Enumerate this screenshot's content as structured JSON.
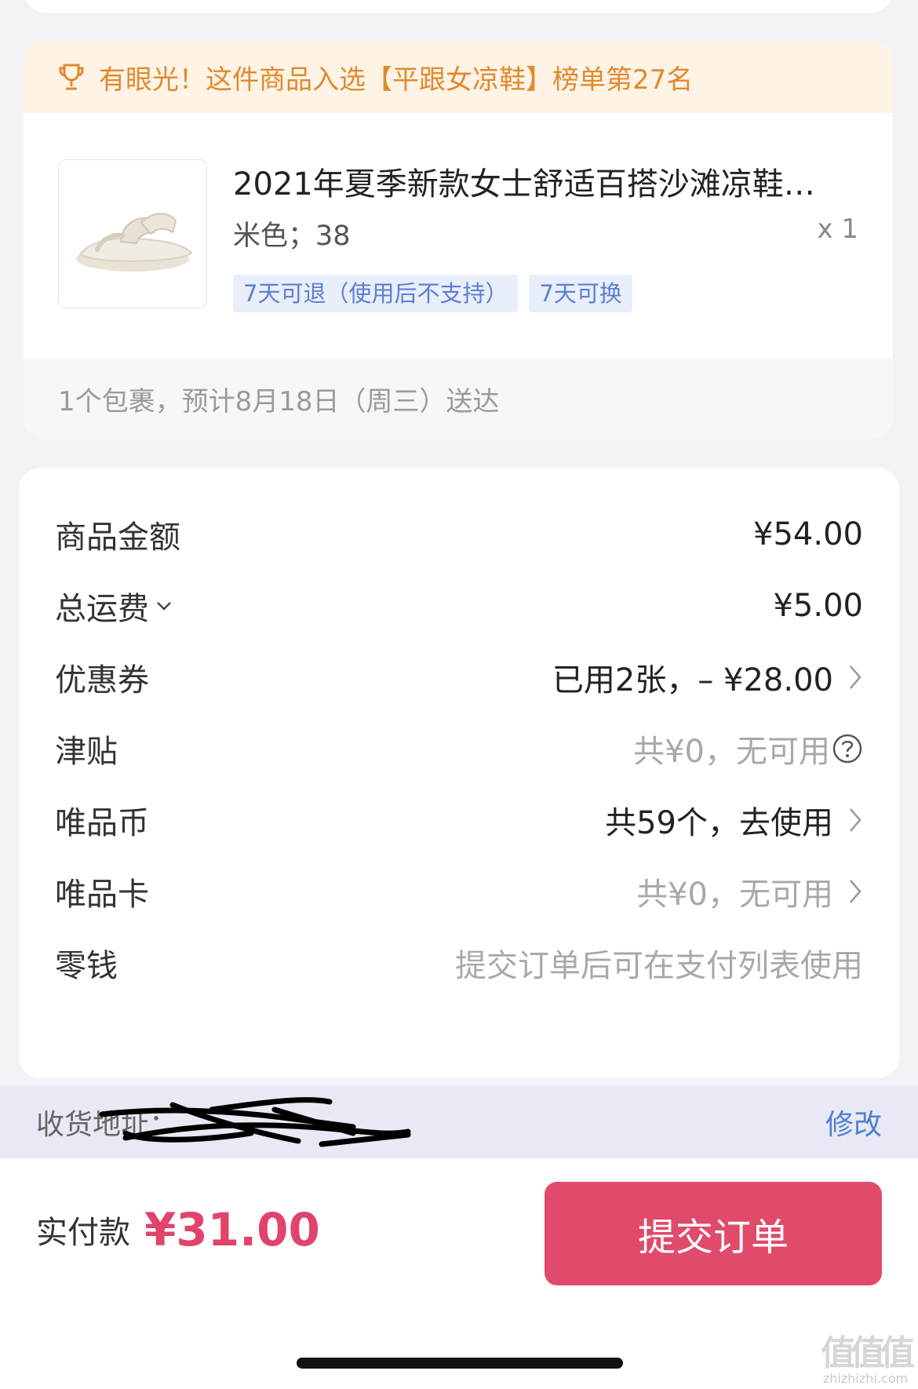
{
  "rank_banner": {
    "text": "有眼光！这件商品入选【平跟女凉鞋】榜单第27名"
  },
  "product": {
    "name": "2021年夏季新款女士舒适百搭沙滩凉鞋…",
    "sku": "米色；38",
    "qty": "x 1",
    "tags": [
      "7天可退（使用后不支持）",
      "7天可换"
    ]
  },
  "delivery": {
    "text": "1个包裹，预计8月18日（周三）送达"
  },
  "summary": {
    "rows": [
      {
        "label": "商品金额",
        "value": "¥54.00"
      },
      {
        "label": "总运费",
        "value": "¥5.00"
      },
      {
        "label": "优惠券",
        "value": "已用2张，– ¥28.00"
      },
      {
        "label": "津贴",
        "value": "共¥0，无可用"
      },
      {
        "label": "唯品币",
        "value": "共59个，去使用"
      },
      {
        "label": "唯品卡",
        "value": "共¥0，无可用"
      },
      {
        "label": "零钱",
        "value": "提交订单后可在支付列表使用"
      }
    ]
  },
  "address": {
    "label": "收货地址：",
    "edit_label": "修改"
  },
  "footer": {
    "total_label": "实付款",
    "total_amount": "¥31.00",
    "submit_label": "提交订单"
  },
  "watermark": {
    "glyphs": "值值值",
    "site": "zhizhizhi.com"
  },
  "colors": {
    "accent": "#e04a6b",
    "banner_text": "#e08a2c",
    "banner_bg": "#fff3e6",
    "tag_text": "#5b7fd1",
    "link": "#4f7fd1"
  }
}
